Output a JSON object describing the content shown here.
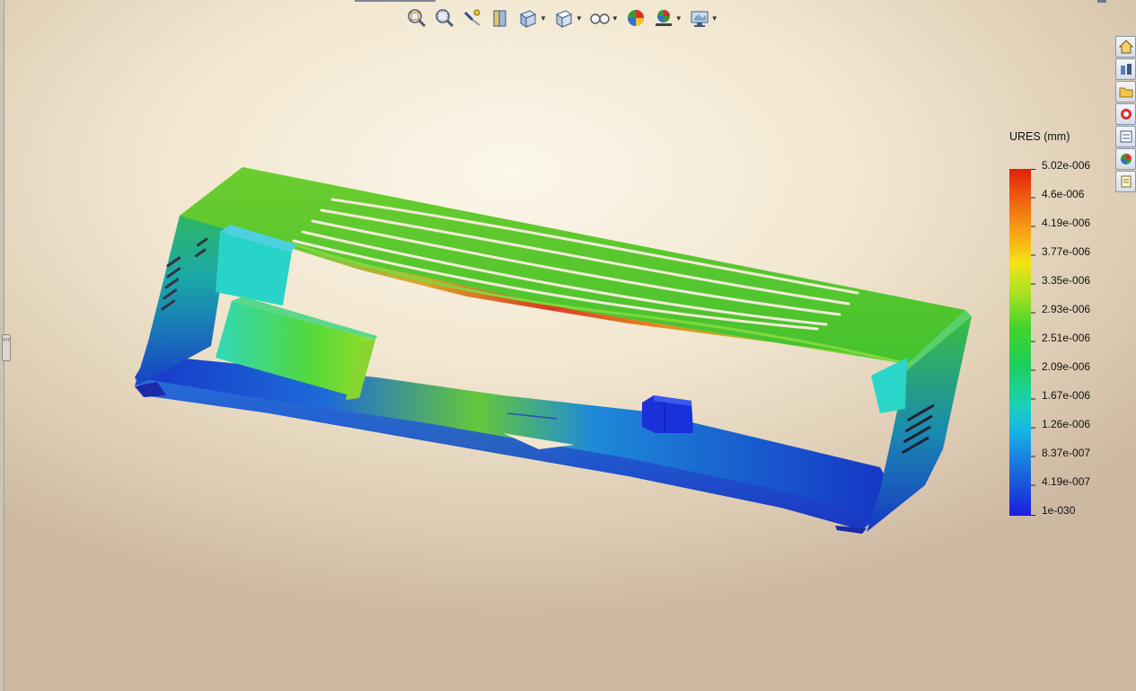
{
  "toolbar": {
    "icons": [
      "zoom-to-fit-icon",
      "zoom-to-area-icon",
      "rotate-view-icon",
      "section-view-icon",
      "view-orientation-icon",
      "display-style-icon",
      "hide-show-icon",
      "edit-appearance-icon",
      "apply-scene-icon",
      "view-settings-icon"
    ]
  },
  "task_pane": {
    "icons": [
      "home-icon",
      "resources-icon",
      "folder-icon",
      "appearances-icon",
      "custom-properties-icon",
      "color-wheel-icon",
      "notes-icon"
    ]
  },
  "legend": {
    "title": "URES (mm)",
    "labels": [
      "5.02e-006",
      "4.6e-006",
      "4.19e-006",
      "3.77e-006",
      "3.35e-006",
      "2.93e-006",
      "2.51e-006",
      "2.09e-006",
      "1.67e-006",
      "1.26e-006",
      "8.37e-007",
      "4.19e-007",
      "1e-030"
    ],
    "max_color": "#e0200c",
    "mid_color": "#40d42c",
    "min_color": "#1a1ee0"
  },
  "left_handle": {
    "label": "›››"
  }
}
